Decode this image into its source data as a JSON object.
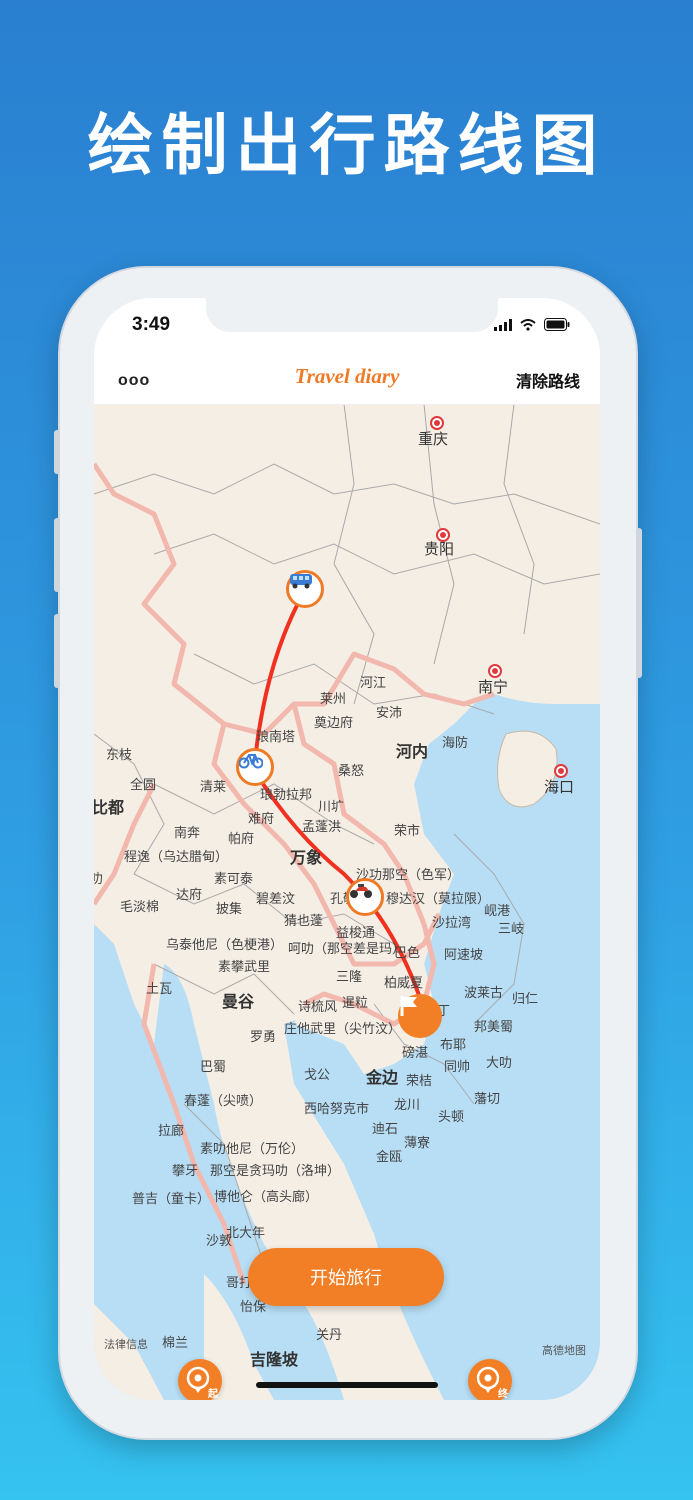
{
  "headline": "绘制出行路线图",
  "status_bar": {
    "time": "3:49"
  },
  "navbar": {
    "menu": "ooo",
    "title": "Travel diary",
    "clear_route": "清除路线"
  },
  "map": {
    "capitals": [
      "重庆",
      "贵阳",
      "南宁",
      "海口"
    ],
    "major_cities": [
      "河内",
      "万象",
      "曼谷",
      "金边",
      "吉隆坡"
    ],
    "edge_labels": [
      "比都"
    ],
    "cities": [
      "莱州",
      "河江",
      "奠边府",
      "安沛",
      "琅南塔",
      "海防",
      "东枝",
      "清莱",
      "琅勃拉邦",
      "桑怒",
      "全圆",
      "南奔",
      "帕府",
      "难府",
      "川圹",
      "孟蓬洪",
      "荣市",
      "程逸（乌达腊甸）",
      "叻",
      "素可泰",
      "沙功那空（色军）",
      "毛淡棉",
      "达府",
      "碧差汶",
      "孔敬",
      "穆达汉（莫拉限）",
      "岘港",
      "披集",
      "猜也蓬",
      "沙拉湾",
      "三岐",
      "乌泰他尼（色梗港）",
      "呵叻（那空差是玛）",
      "益梭通",
      "巴色",
      "阿速坡",
      "素攀武里",
      "土瓦",
      "三隆",
      "柏威夏",
      "波莱古",
      "归仁",
      "诗梳风",
      "暹粒",
      "上丁",
      "邦美蜀",
      "罗勇",
      "庄他武里（尖竹汶）",
      "布耶",
      "巴蜀",
      "磅湛",
      "同帅",
      "大叻",
      "戈公",
      "荣桔",
      "春蓬（尖喷）",
      "西哈努克市",
      "龙川",
      "头顿",
      "藩切",
      "拉廊",
      "迪石",
      "薄寮",
      "素叻他尼（万伦）",
      "金瓯",
      "攀牙",
      "那空是贪玛叻（洛坤）",
      "普吉（童卡）",
      "博他仑（高头廊）",
      "北大年",
      "沙敦",
      "哥打",
      "怡保",
      "关丹",
      "棉兰"
    ],
    "watermark_left": "法律信息",
    "watermark_right": "高德地图"
  },
  "route": {
    "waypoint_icons": [
      "bus-icon",
      "bicycle-icon",
      "motorcycle-icon",
      "flag-icon"
    ],
    "color": "#f0311f"
  },
  "controls": {
    "start_label": "起",
    "start_trip": "开始旅行",
    "end_label": "终"
  },
  "colors": {
    "accent": "#f27f25",
    "title": "#ee7a26"
  }
}
